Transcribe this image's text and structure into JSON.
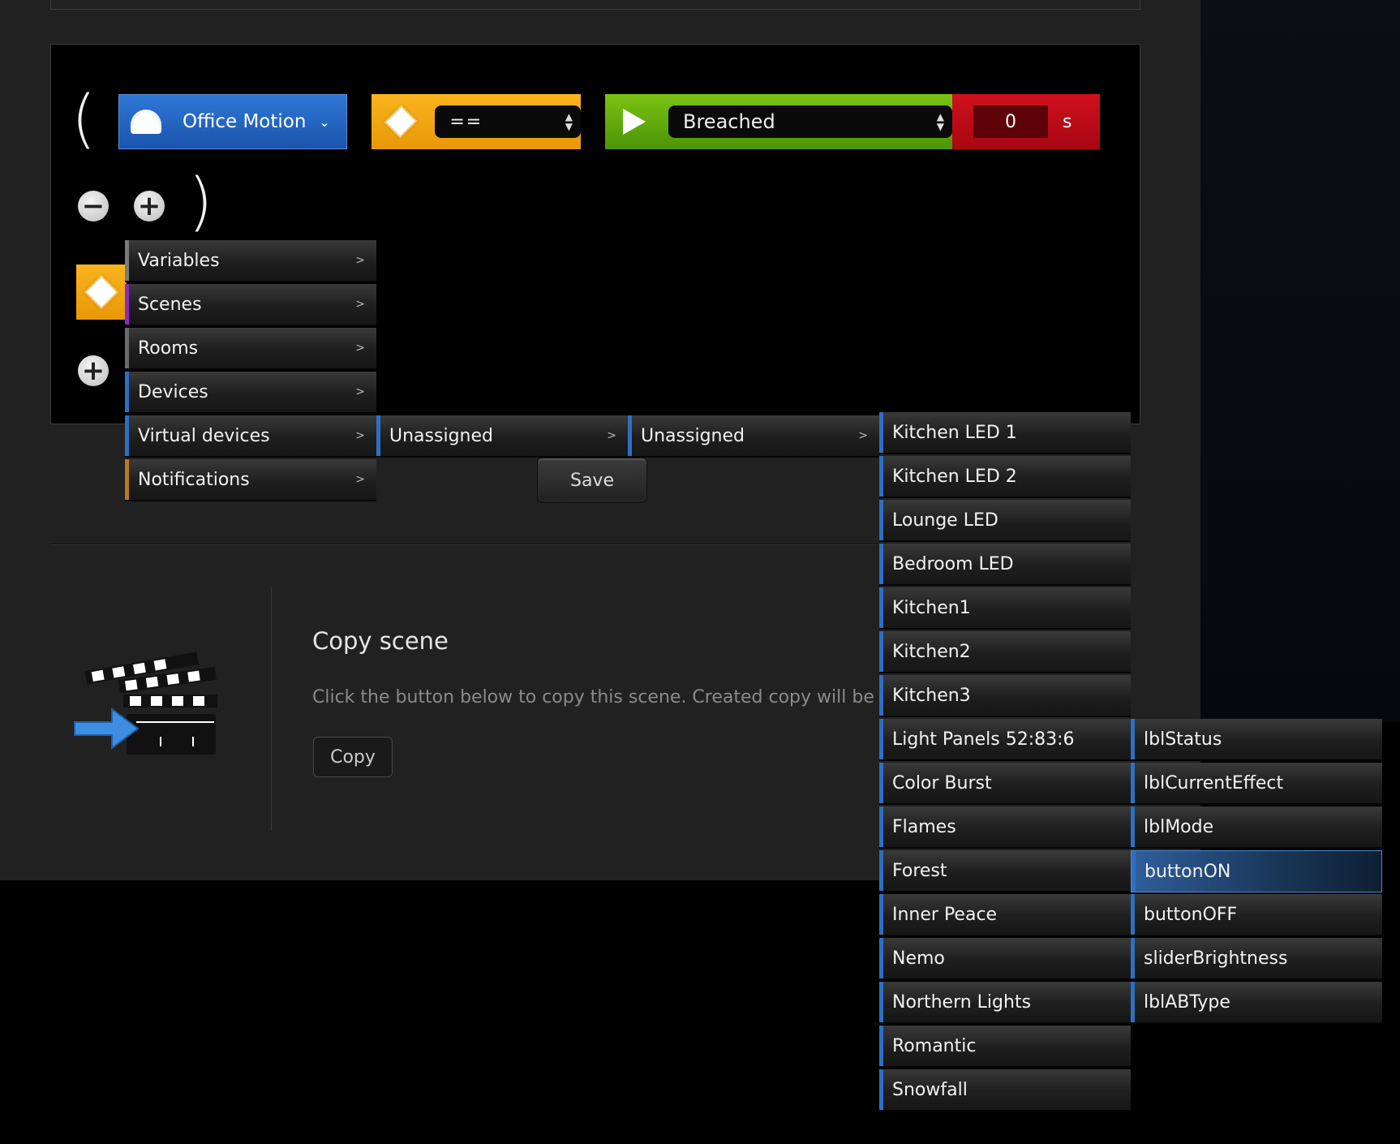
{
  "condition": {
    "open_paren": "(",
    "close_paren": ")",
    "device": {
      "label": "Office Motion",
      "icon": "motion-sensor-icon",
      "chevron": "⌄"
    },
    "operator": {
      "value": "==",
      "icon": "diamond-icon"
    },
    "value": {
      "value": "Breached",
      "icon": "play-icon"
    },
    "delay": {
      "value": "0",
      "unit": "s"
    },
    "minus_icon": "−",
    "plus_icon": "+"
  },
  "menu": {
    "items": [
      {
        "label": "Variables",
        "color": "#7a7a7a"
      },
      {
        "label": "Scenes",
        "color": "#8a2bbf"
      },
      {
        "label": "Rooms",
        "color": "#6a6a6a"
      },
      {
        "label": "Devices",
        "color": "#2d6fc4"
      },
      {
        "label": "Virtual devices",
        "color": "#2d6fc4"
      },
      {
        "label": "Notifications",
        "color": "#b8781d"
      }
    ],
    "chev": ">"
  },
  "submenu1": {
    "label": "Unassigned"
  },
  "submenu2": {
    "label": "Unassigned"
  },
  "virtual_devices": [
    "Kitchen LED 1",
    "Kitchen LED 2",
    "Lounge LED",
    "Bedroom LED",
    "Kitchen1",
    "Kitchen2",
    "Kitchen3",
    "Light Panels 52:83:6",
    "Color Burst",
    "Flames",
    "Forest",
    "Inner Peace",
    "Nemo",
    "Northern Lights",
    "Romantic",
    "Snowfall"
  ],
  "controls": [
    "lblStatus",
    "lblCurrentEffect",
    "lblMode",
    "buttonON",
    "buttonOFF",
    "sliderBrightness",
    "lblABType"
  ],
  "selected_control": "buttonON",
  "save_label": "Save",
  "copy": {
    "title": "Copy scene",
    "description": "Click the button below to copy this scene. Created copy will be",
    "button": "Copy"
  }
}
